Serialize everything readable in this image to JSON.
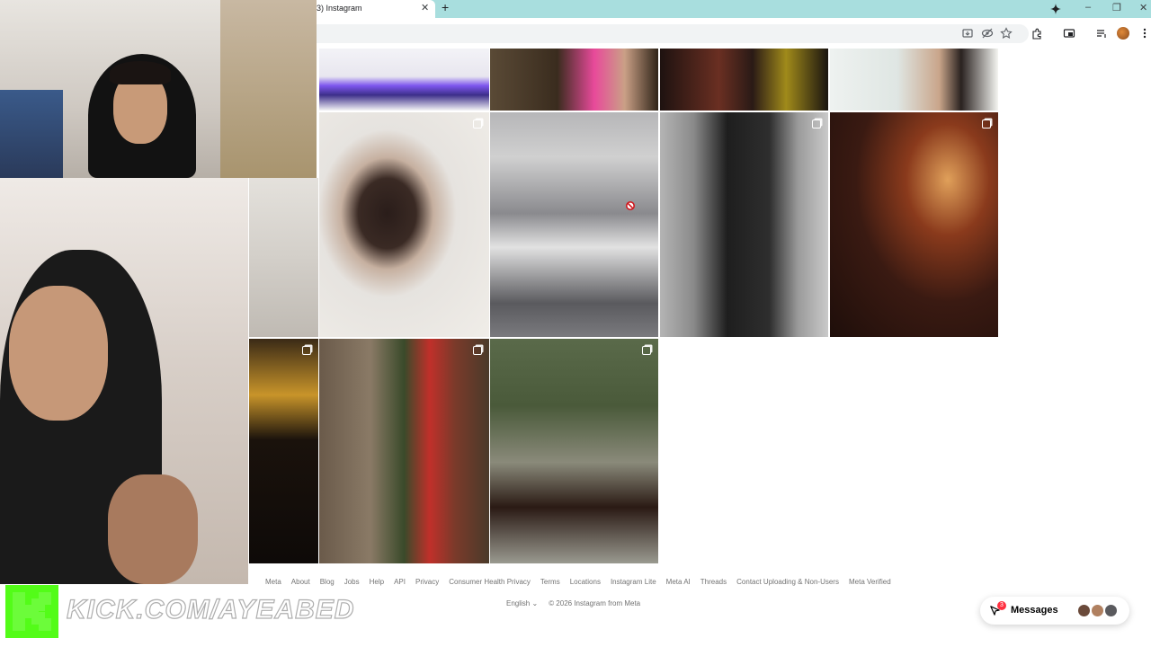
{
  "browser": {
    "tab_title": "3) Instagram",
    "tab_close": "✕",
    "new_tab": "+",
    "window_controls": {
      "minimize": "–",
      "restore": "❐",
      "close": "✕"
    },
    "toolbar_icons": [
      "install-app-icon",
      "eye-off-icon",
      "bookmark-star-icon",
      "extensions-icon",
      "screen-share-icon",
      "media-controls-icon",
      "profile-avatar",
      "kebab-menu-icon"
    ]
  },
  "instagram": {
    "grid_tiles": [
      {
        "name": "post-led-lights",
        "colors": [
          "#f2f2f6",
          "#6a43e6",
          "#3d2f8a"
        ]
      },
      {
        "name": "post-boat-pink",
        "colors": [
          "#4a3a2a",
          "#e84a9a",
          "#2f2418"
        ]
      },
      {
        "name": "post-dark-dress",
        "colors": [
          "#2a1a16",
          "#7a3f2a",
          "#a08a1a"
        ]
      },
      {
        "name": "post-pool-legs",
        "colors": [
          "#dfe6e3",
          "#c9a58a",
          "#f4f5f1"
        ]
      },
      {
        "name": "post-lying-portrait",
        "colors": [
          "#e6e3df",
          "#2a1d1a",
          "#f0ede8"
        ],
        "multi": true
      },
      {
        "name": "post-car-pose",
        "colors": [
          "#9a9a9c",
          "#d8d8d8",
          "#5a5a5e"
        ]
      },
      {
        "name": "post-bw-leather-jacket",
        "colors": [
          "#9a9a9a",
          "#1e1e1e",
          "#c9c9c9"
        ],
        "multi": true
      },
      {
        "name": "post-restaurant-interior",
        "colors": [
          "#2a1410",
          "#8a3a1c",
          "#e0a05a"
        ],
        "multi": true
      },
      {
        "name": "post-brownstone-street",
        "colors": [
          "#6a5a4a",
          "#3a4a2a",
          "#c0302a"
        ]
      },
      {
        "name": "post-plaza-bench",
        "colors": [
          "#4a5a3a",
          "#8a8a7a",
          "#2a1a14"
        ],
        "multi": true
      }
    ],
    "footer_links": [
      "Meta",
      "About",
      "Blog",
      "Jobs",
      "Help",
      "API",
      "Privacy",
      "Consumer Health Privacy",
      "Terms",
      "Locations",
      "Instagram Lite",
      "Meta AI",
      "Threads",
      "Contact Uploading & Non-Users",
      "Meta Verified"
    ],
    "language": "English",
    "language_chevron": "⌄",
    "copyright": "© 2026 Instagram from Meta",
    "messages": {
      "label": "Messages",
      "badge": "3"
    }
  },
  "stream": {
    "kick_logo_letter": "K",
    "kick_url": "KICK.COM/AYEABED",
    "brand_color": "#53fc18"
  }
}
